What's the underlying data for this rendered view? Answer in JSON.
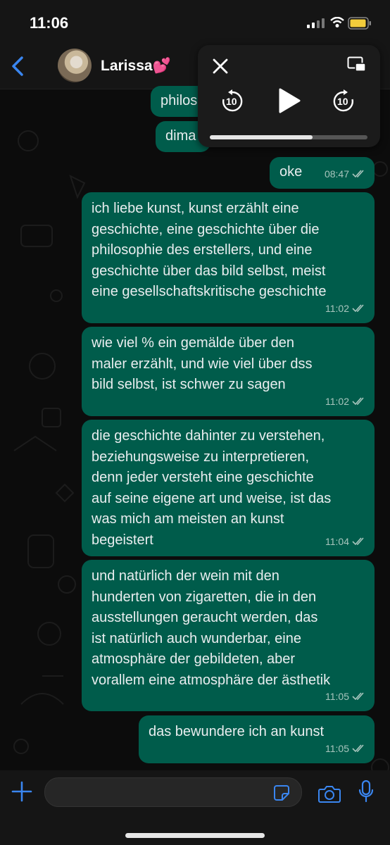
{
  "status": {
    "time": "11:06"
  },
  "header": {
    "contact_name": "Larissa💕"
  },
  "pip": {
    "progress": 0.65,
    "skip_seconds": "10"
  },
  "messages": [
    {
      "text": "philos",
      "time": ""
    },
    {
      "text": "dima",
      "time": ""
    },
    {
      "text": "oke",
      "time": "08:47"
    },
    {
      "text": "ich liebe kunst, kunst erzählt eine\ngeschichte, eine geschichte über die\nphilosophie des erstellers, und eine\ngeschichte über das bild selbst, meist\neine gesellschaftskritische geschichte",
      "time": "11:02"
    },
    {
      "text": "wie viel % ein gemälde über den\nmaler erzählt, und wie viel über dss\nbild selbst, ist schwer zu sagen",
      "time": "11:02"
    },
    {
      "text": "die geschichte dahinter zu verstehen,\nbeziehungsweise zu interpretieren,\ndenn jeder versteht eine geschichte\nauf seine eigene art und weise, ist das\nwas mich am meisten an kunst\nbegeistert",
      "time": "11:04"
    },
    {
      "text": "und natürlich der wein mit den\nhunderten von zigaretten, die in den\nausstellungen geraucht werden, das\nist natürlich auch wunderbar, eine\natmosphäre der gebildeten, aber\nvorallem eine atmosphäre der ästhetik",
      "time": "11:05"
    },
    {
      "text": "das bewundere ich an kunst",
      "time": "11:05"
    }
  ],
  "composer": {
    "input_value": ""
  },
  "colors": {
    "bubble_out": "#005c4b",
    "accent": "#3a86f0",
    "background": "#0b0b0b"
  }
}
